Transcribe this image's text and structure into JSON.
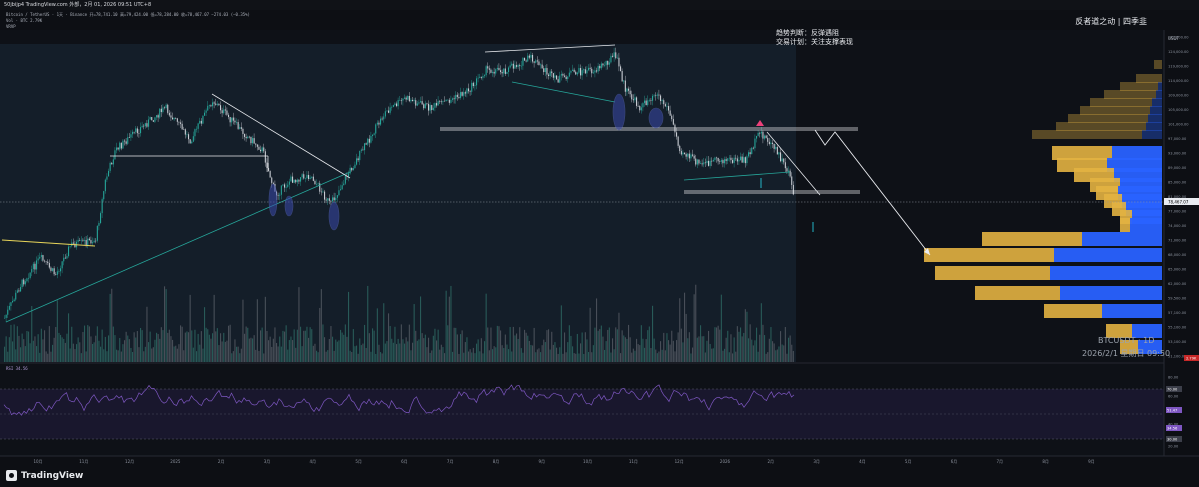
{
  "header": {
    "title": "50jbijp4 TradingView.com 外部，2月 01, 2026 09:51 UTC+8"
  },
  "legend": {
    "line1": "Bitcoin / TetherUS · 1天 · Binance  开=78,741.10  高=79,424.00  低=78,284.00  收=78,467.07  −274.03 (−0.35%)",
    "line2": "Vol · BTC  2.79K",
    "line3": "VRVP",
    "rsi": "RSI  34.56"
  },
  "notes": {
    "line1": "趋势判断：反弹遇阻",
    "line2": "交易计划：关注支撑表现",
    "brand": "反者道之动 | 四季韭"
  },
  "overlay": {
    "symbol": "BTCUSDT · 1D",
    "timestamp": "2026/2/1 星期日 09:50"
  },
  "price_axis": {
    "currency": "USDT",
    "labels": [
      "132,000.00",
      "124,000.00",
      "119,000.00",
      "114,000.00",
      "109,000.00",
      "105,000.00",
      "101,000.00",
      "97,000.00",
      "93,000.00",
      "89,000.00",
      "85,000.00",
      "81,000.00",
      "77,000.00",
      "74,000.00",
      "71,000.00",
      "68,000.00",
      "65,000.00",
      "62,000.00",
      "59,500.00",
      "57,100.00",
      "55,100.00",
      "53,100.00",
      "51,100.00"
    ],
    "current_price": "78,467.07",
    "volume_badge": "2.79K"
  },
  "rsi_axis": {
    "labels": [
      "80.00",
      "60.00",
      "40.00",
      "20.00"
    ],
    "badges": [
      "70.00",
      "51.47",
      "34.56",
      "30.00"
    ]
  },
  "time_axis": {
    "labels": [
      "10月",
      "11月",
      "12月",
      "2025",
      "2月",
      "3月",
      "4月",
      "5月",
      "6月",
      "7月",
      "8月",
      "9月",
      "10月",
      "11月",
      "12月",
      "2026",
      "2月",
      "3月",
      "4月",
      "5月",
      "6月",
      "7月",
      "8月",
      "9月"
    ]
  },
  "footer": {
    "brand": "TradingView"
  },
  "colors": {
    "background": "#0d0f14",
    "candle_up": "#26a69a",
    "candle_down": "#c8ccd3",
    "profile_up": "#2962ff",
    "profile_down": "#e3b341",
    "rsi": "#7e57c2"
  }
}
